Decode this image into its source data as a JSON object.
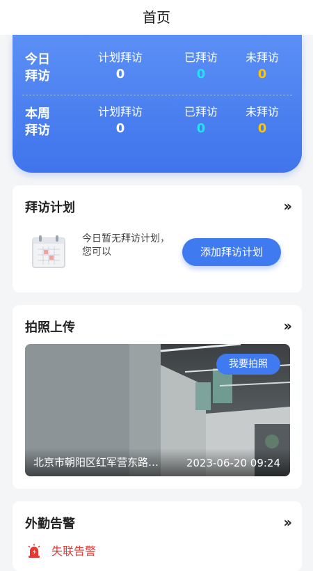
{
  "header": {
    "title": "首页"
  },
  "stats": {
    "today": {
      "label_line1": "今日",
      "label_line2": "拜访",
      "planned_label": "计划拜访",
      "planned_value": "0",
      "visited_label": "已拜访",
      "visited_value": "0",
      "unvisited_label": "未拜访",
      "unvisited_value": "0"
    },
    "week": {
      "label_line1": "本周",
      "label_line2": "拜访",
      "planned_label": "计划拜访",
      "planned_value": "0",
      "visited_label": "已拜访",
      "visited_value": "0",
      "unvisited_label": "未拜访",
      "unvisited_value": "0"
    }
  },
  "visit_plan": {
    "title": "拜访计划",
    "more": "››",
    "empty_line1": "今日暂无拜访计划，",
    "empty_line2": "您可以",
    "add_button": "添加拜访计划",
    "icon": "calendar-icon"
  },
  "photo_upload": {
    "title": "拍照上传",
    "more": "››",
    "take_button": "我要拍照",
    "address": "北京市朝阳区红军营东路…",
    "timestamp": "2023-06-20 09:24"
  },
  "field_alarm": {
    "title": "外勤告警",
    "more": "››",
    "item_label": "失联告警",
    "icon": "alarm-icon"
  },
  "colors": {
    "accent": "#3f7af0",
    "visited": "#22e4f6",
    "unvisited": "#ffc400",
    "alarm": "#e53935"
  }
}
